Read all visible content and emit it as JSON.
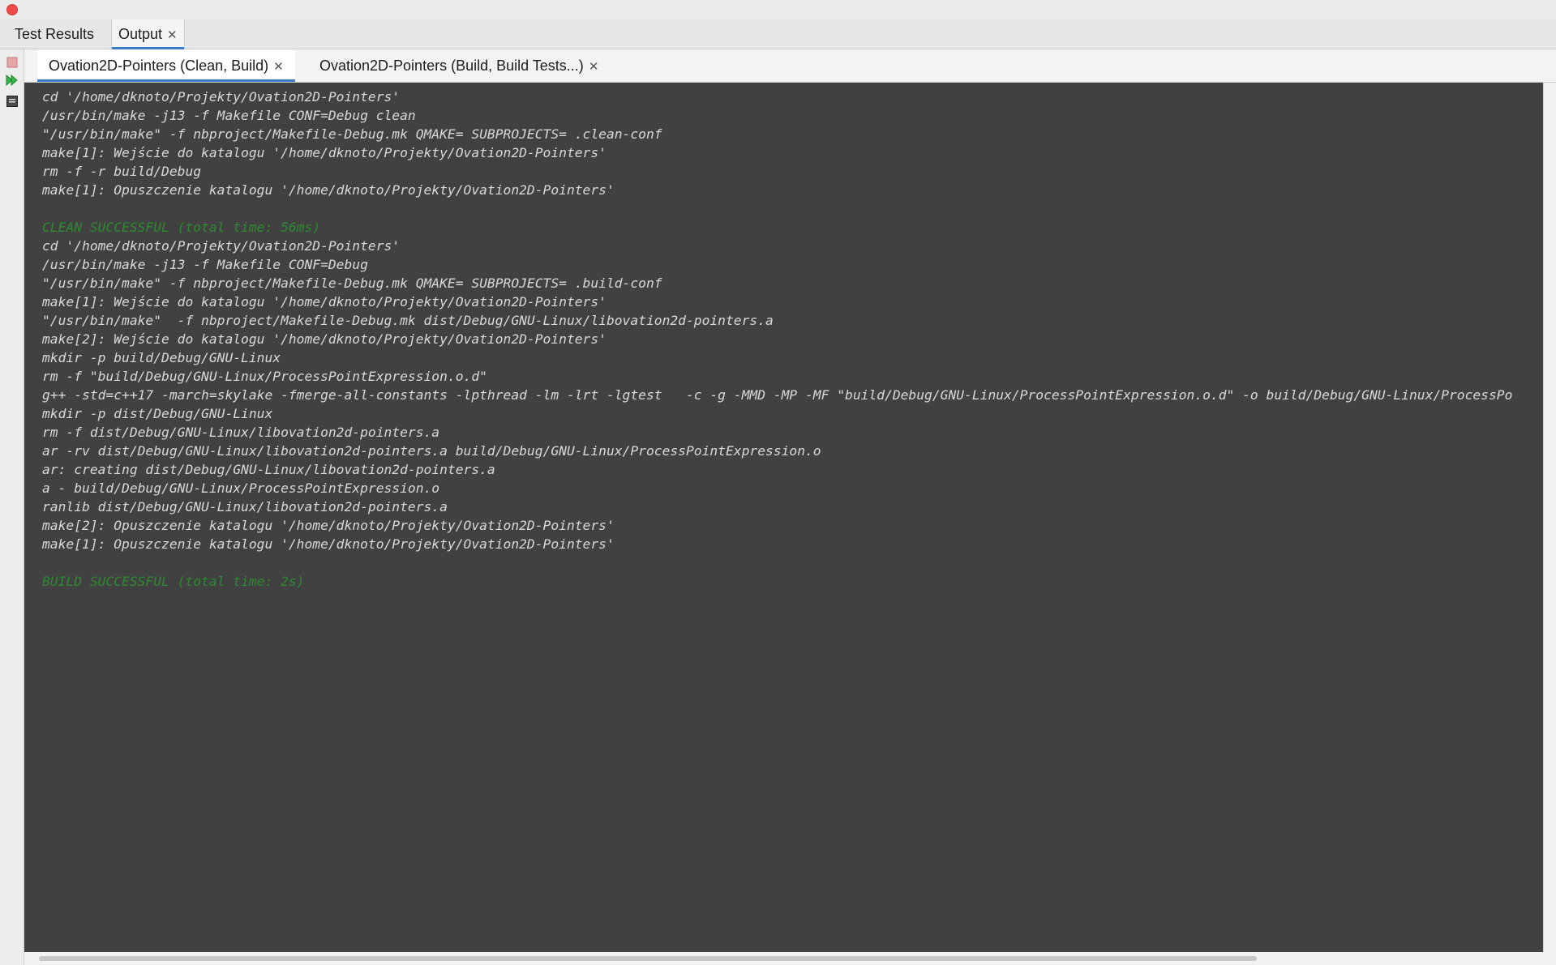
{
  "window": {
    "close_color": "#ef4b4b"
  },
  "panel_tabs": [
    {
      "label": "Test Results",
      "active": false
    },
    {
      "label": "Output",
      "active": true,
      "closable": true
    }
  ],
  "sub_tabs": [
    {
      "label": "Ovation2D-Pointers (Clean, Build)",
      "active": true
    },
    {
      "label": "Ovation2D-Pointers (Build, Build Tests...)",
      "active": false
    }
  ],
  "toolbar": {
    "items": [
      {
        "icon": "stop-icon"
      },
      {
        "icon": "rerun-icon"
      },
      {
        "icon": "clear-output-icon"
      }
    ]
  },
  "colors": {
    "accent": "#3d7cc9",
    "console_bg": "#414141",
    "console_text": "#d9d9d9",
    "success_text": "#2d8a31"
  },
  "console": {
    "lines": [
      "cd '/home/dknoto/Projekty/Ovation2D-Pointers'",
      "/usr/bin/make -j13 -f Makefile CONF=Debug clean",
      "\"/usr/bin/make\" -f nbproject/Makefile-Debug.mk QMAKE= SUBPROJECTS= .clean-conf",
      "make[1]: Wejście do katalogu '/home/dknoto/Projekty/Ovation2D-Pointers'",
      "rm -f -r build/Debug",
      "make[1]: Opuszczenie katalogu '/home/dknoto/Projekty/Ovation2D-Pointers'",
      "",
      "CLEAN SUCCESSFUL (total time: 56ms)",
      "cd '/home/dknoto/Projekty/Ovation2D-Pointers'",
      "/usr/bin/make -j13 -f Makefile CONF=Debug",
      "\"/usr/bin/make\" -f nbproject/Makefile-Debug.mk QMAKE= SUBPROJECTS= .build-conf",
      "make[1]: Wejście do katalogu '/home/dknoto/Projekty/Ovation2D-Pointers'",
      "\"/usr/bin/make\"  -f nbproject/Makefile-Debug.mk dist/Debug/GNU-Linux/libovation2d-pointers.a",
      "make[2]: Wejście do katalogu '/home/dknoto/Projekty/Ovation2D-Pointers'",
      "mkdir -p build/Debug/GNU-Linux",
      "rm -f \"build/Debug/GNU-Linux/ProcessPointExpression.o.d\"",
      "g++ -std=c++17 -march=skylake -fmerge-all-constants -lpthread -lm -lrt -lgtest   -c -g -MMD -MP -MF \"build/Debug/GNU-Linux/ProcessPointExpression.o.d\" -o build/Debug/GNU-Linux/ProcessPo",
      "mkdir -p dist/Debug/GNU-Linux",
      "rm -f dist/Debug/GNU-Linux/libovation2d-pointers.a",
      "ar -rv dist/Debug/GNU-Linux/libovation2d-pointers.a build/Debug/GNU-Linux/ProcessPointExpression.o",
      "ar: creating dist/Debug/GNU-Linux/libovation2d-pointers.a",
      "a - build/Debug/GNU-Linux/ProcessPointExpression.o",
      "ranlib dist/Debug/GNU-Linux/libovation2d-pointers.a",
      "make[2]: Opuszczenie katalogu '/home/dknoto/Projekty/Ovation2D-Pointers'",
      "make[1]: Opuszczenie katalogu '/home/dknoto/Projekty/Ovation2D-Pointers'",
      "",
      "BUILD SUCCESSFUL (total time: 2s)"
    ]
  }
}
